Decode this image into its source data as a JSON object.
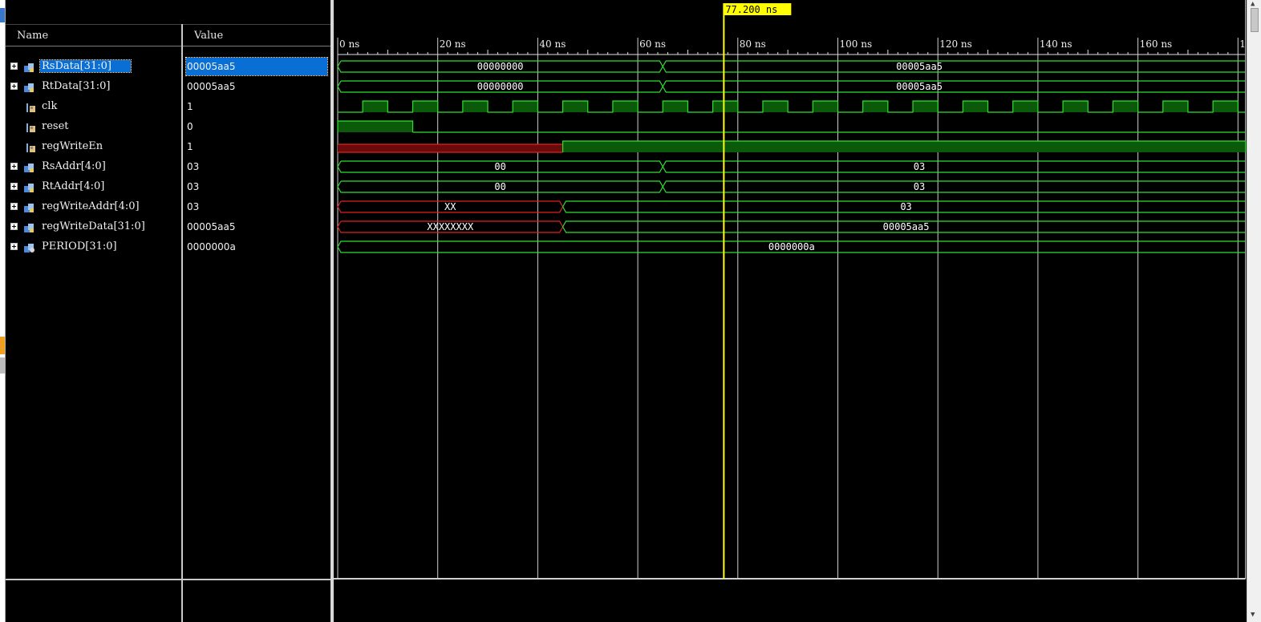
{
  "panel": {
    "name_header": "Name",
    "value_header": "Value"
  },
  "cursor": {
    "time_label": "77.200 ns",
    "time_ns": 77.2
  },
  "timeline": {
    "view_start_ns": 0,
    "view_end_ns": 181.5,
    "ticks": [
      {
        "ns": 0,
        "label": "0 ns"
      },
      {
        "ns": 20,
        "label": "20 ns"
      },
      {
        "ns": 40,
        "label": "40 ns"
      },
      {
        "ns": 60,
        "label": "60 ns"
      },
      {
        "ns": 80,
        "label": "80 ns"
      },
      {
        "ns": 100,
        "label": "100 ns"
      },
      {
        "ns": 120,
        "label": "120 ns"
      },
      {
        "ns": 140,
        "label": "140 ns"
      },
      {
        "ns": 160,
        "label": "160 ns"
      },
      {
        "ns": 180,
        "label": "1"
      }
    ]
  },
  "signals": [
    {
      "name": "RsData[31:0]",
      "value": "00005aa5",
      "kind": "bus",
      "selected": true,
      "segments": [
        {
          "t0": 0,
          "t1": 65,
          "label": "00000000",
          "state": "valid"
        },
        {
          "t0": 65,
          "t1": 181.5,
          "label": "00005aa5",
          "state": "valid"
        }
      ]
    },
    {
      "name": "RtData[31:0]",
      "value": "00005aa5",
      "kind": "bus",
      "selected": false,
      "segments": [
        {
          "t0": 0,
          "t1": 65,
          "label": "00000000",
          "state": "valid"
        },
        {
          "t0": 65,
          "t1": 181.5,
          "label": "00005aa5",
          "state": "valid"
        }
      ]
    },
    {
      "name": "clk",
      "value": "1",
      "kind": "bit",
      "waveform": "clock",
      "period_ns": 10,
      "first_rise_ns": 5
    },
    {
      "name": "reset",
      "value": "0",
      "kind": "bit",
      "waveform": "steps",
      "steps": [
        {
          "t0": 0,
          "t1": 15,
          "level": 1
        },
        {
          "t0": 15,
          "t1": 181.5,
          "level": 0
        }
      ]
    },
    {
      "name": "regWriteEn",
      "value": "1",
      "kind": "bit",
      "waveform": "steps",
      "steps": [
        {
          "t0": 0,
          "t1": 45,
          "level": "x"
        },
        {
          "t0": 45,
          "t1": 181.5,
          "level": 1
        }
      ]
    },
    {
      "name": "RsAddr[4:0]",
      "value": "03",
      "kind": "bus",
      "segments": [
        {
          "t0": 0,
          "t1": 65,
          "label": "00",
          "state": "valid"
        },
        {
          "t0": 65,
          "t1": 181.5,
          "label": "03",
          "state": "valid"
        }
      ]
    },
    {
      "name": "RtAddr[4:0]",
      "value": "03",
      "kind": "bus",
      "segments": [
        {
          "t0": 0,
          "t1": 65,
          "label": "00",
          "state": "valid"
        },
        {
          "t0": 65,
          "t1": 181.5,
          "label": "03",
          "state": "valid"
        }
      ]
    },
    {
      "name": "regWriteAddr[4:0]",
      "value": "03",
      "kind": "bus",
      "segments": [
        {
          "t0": 0,
          "t1": 45,
          "label": "XX",
          "state": "x"
        },
        {
          "t0": 45,
          "t1": 181.5,
          "label": "03",
          "state": "valid"
        }
      ]
    },
    {
      "name": "regWriteData[31:0]",
      "value": "00005aa5",
      "kind": "bus",
      "segments": [
        {
          "t0": 0,
          "t1": 45,
          "label": "XXXXXXXX",
          "state": "x"
        },
        {
          "t0": 45,
          "t1": 181.5,
          "label": "00005aa5",
          "state": "valid"
        }
      ]
    },
    {
      "name": "PERIOD[31:0]",
      "value": "0000000a",
      "kind": "param",
      "segments": [
        {
          "t0": 0,
          "t1": 181.5,
          "label": "0000000a",
          "state": "valid"
        }
      ]
    }
  ],
  "colors": {
    "wave": "#2ee02e",
    "wave_fill": "#0a5a0a",
    "x_line": "#e02020",
    "x_fill": "#6a0a0a",
    "cursor": "#ffff00",
    "grid": "#cfcfcf",
    "selection": "#0a6fd4",
    "text": "#ffffff"
  },
  "icons": {
    "bus": "bus-signal-icon",
    "bit": "bit-signal-icon",
    "param": "parameter-icon"
  }
}
